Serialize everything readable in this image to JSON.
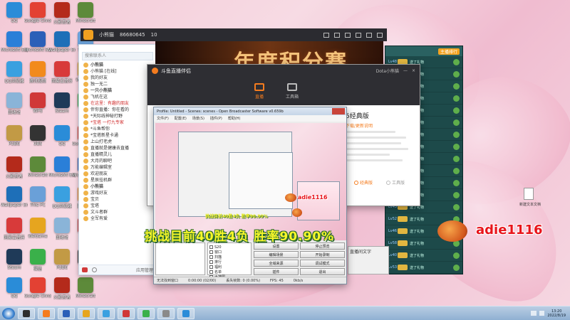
{
  "desktop_icons": [
    {
      "label": "QQ",
      "color": "#2a8cd8"
    },
    {
      "label": "Google Chrome",
      "color": "#e34133"
    },
    {
      "label": "火影忍者",
      "color": "#b42a1b"
    },
    {
      "label": "Minecraft",
      "color": "#5d8a3a"
    },
    {
      "label": "Microsoft Edge",
      "color": "#2a7fd8"
    },
    {
      "label": "Microsoft Store",
      "color": "#2b5fb8"
    },
    {
      "label": "Wallpaper Engine",
      "color": "#1e6fb8"
    },
    {
      "label": "This PC",
      "color": "#6aa0d8"
    },
    {
      "label": "QQ浏览器",
      "color": "#3aa0e0"
    },
    {
      "label": "腾讯视频",
      "color": "#f28a1c"
    },
    {
      "label": "网易云音乐",
      "color": "#d83a3a"
    },
    {
      "label": "WeGame",
      "color": "#e6a51f"
    },
    {
      "label": "回收站",
      "color": "#8ab4d8"
    },
    {
      "label": "WPS",
      "color": "#d03838"
    },
    {
      "label": "Steam",
      "color": "#1f3a58"
    },
    {
      "label": "微信",
      "color": "#3ab04a"
    },
    {
      "label": "PUBG",
      "color": "#c29a45"
    },
    {
      "label": "OBS",
      "color": "#333333"
    }
  ],
  "qq": {
    "search_placeholder": "搜索联系人",
    "rows": [
      {
        "text": "小熊猫",
        "style": "grp"
      },
      {
        "text": "小熊猫 [在线]",
        "style": "normal"
      },
      {
        "text": "我的好友",
        "style": "normal"
      },
      {
        "text": "独一无二",
        "style": "normal"
      },
      {
        "text": "一只小熊猫",
        "style": "grp"
      },
      {
        "text": "飞机在这",
        "style": "normal"
      },
      {
        "text": "在这里：有趣的朋友",
        "style": "red"
      },
      {
        "text": "伴你直播：你在看的",
        "style": "normal"
      },
      {
        "text": "*天际线神秘打野",
        "style": "normal"
      },
      {
        "text": "*宝塔 一打九专家",
        "style": "red"
      },
      {
        "text": "*斗鱼帮你",
        "style": "normal"
      },
      {
        "text": "*宝塔新星卡通",
        "style": "normal"
      },
      {
        "text": "上山打老虎",
        "style": "normal"
      },
      {
        "text": "直播就是健康去直播",
        "style": "normal"
      },
      {
        "text": "直播精灵儿",
        "style": "normal"
      },
      {
        "text": "大月的聊吧",
        "style": "normal"
      },
      {
        "text": "万能编辑室",
        "style": "normal"
      },
      {
        "text": "欢迎朋友",
        "style": "normal"
      },
      {
        "text": "星辰挂机群",
        "style": "normal"
      },
      {
        "text": "小熊猫",
        "style": "grp"
      },
      {
        "text": "游戏好友",
        "style": "normal"
      },
      {
        "text": "宝贝",
        "style": "normal"
      },
      {
        "text": "宝塔",
        "style": "normal"
      },
      {
        "text": "文斗者群",
        "style": "normal"
      },
      {
        "text": "全军有爱",
        "style": "normal"
      }
    ],
    "bottom_label": "应用管理"
  },
  "topbar": {
    "title": "小熊猫",
    "room": "86680645",
    "count": "10"
  },
  "stream": {
    "banner": "年度积分赛"
  },
  "chat": {
    "button": "主播排行",
    "rows": [
      {
        "lv": "Lv48",
        "text": "送了礼物"
      },
      {
        "lv": "Lv45",
        "text": "送了礼物"
      },
      {
        "lv": "Lv60",
        "text": "送了礼物"
      },
      {
        "lv": "Lv42",
        "text": "送了礼物"
      },
      {
        "lv": "Lv39",
        "text": "送了礼物"
      },
      {
        "lv": "Lv61",
        "text": "送了礼物"
      },
      {
        "lv": "Lv55",
        "text": "送了礼物"
      },
      {
        "lv": "Lv44",
        "text": "送了礼物"
      },
      {
        "lv": "Lv50",
        "text": "送了礼物"
      },
      {
        "lv": "Lv41",
        "text": "送了礼物"
      },
      {
        "lv": "Lv49",
        "text": "送了礼物"
      },
      {
        "lv": "Lv57",
        "text": "送了礼物"
      },
      {
        "lv": "Lv43",
        "text": "送了礼物"
      },
      {
        "lv": "Lv52",
        "text": "送了礼物"
      },
      {
        "lv": "Lv46",
        "text": "送了礼物"
      },
      {
        "lv": "Lv58",
        "text": "送了礼物"
      },
      {
        "lv": "Lv40",
        "text": "送了礼物"
      },
      {
        "lv": "Lv53",
        "text": "送了礼物"
      }
    ]
  },
  "douyu": {
    "title": "斗鱼直播伴侣",
    "user": "Dota小熊猫",
    "tab_live": "直播",
    "tab_tools": "工具箱",
    "version": "5经典版",
    "link": "下载/更新说明",
    "radio_on": "经典版",
    "radio_off": "工具版"
  },
  "obs": {
    "title": "Profile: Untitled - Scenes: scenes - Open Broadcaster Software v0.659b",
    "menu": [
      "文件(F)",
      "配置(E)",
      "场景(S)",
      "插件(P)",
      "帮助(H)"
    ],
    "sources": [
      "S20",
      "窗口",
      "扫描",
      "排行",
      "福利",
      "名单",
      "大神图"
    ],
    "buttons": [
      "设置",
      "停止预览",
      "编辑场景",
      "开始录制",
      "全域来源",
      "调试模式",
      "插件",
      "退出"
    ],
    "status_left": "无法找到窗口",
    "status_time": "0:00:00 (02/00)",
    "status_drop": "丢失帧数: 0 (0.00%)",
    "status_fps": "FPS: 45",
    "status_rate": "0kb/s"
  },
  "behind": {
    "label": "直播间文字"
  },
  "overlay": {
    "headline": "挑战目前40胜4负  胜率90.90%",
    "name_big": "adie1116",
    "name_small": "adie1116",
    "small_caption": "挑战目前40胜4负 胜率90.90%"
  },
  "desktop_file": {
    "label": "新建文本文档"
  },
  "taskbar": {
    "time": "13:20",
    "date": "2022/8/19",
    "apps": [
      "#2f2f2f",
      "#f47c1f",
      "#2b5fb8",
      "#e6a51f",
      "#3aa0e0",
      "#d03838",
      "#3ab04a",
      "#8a8a8a",
      "#2a8cd8"
    ]
  }
}
